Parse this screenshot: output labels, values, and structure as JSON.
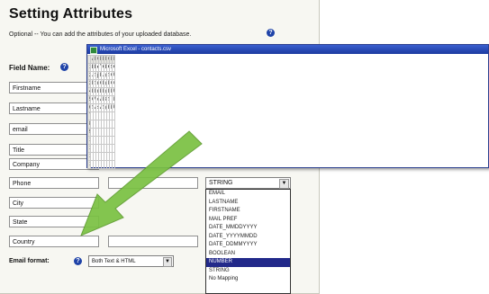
{
  "panel": {
    "title": "Setting Attributes",
    "subtitle": "Optional -- You can add the attributes of your uploaded database.",
    "help_glyph": "?",
    "field_name_label": "Field Name:",
    "fields": [
      "Firstname",
      "Lastname",
      "email",
      "Title",
      "Company",
      "Phone",
      "City",
      "State",
      "Country"
    ],
    "type_select": {
      "value": "STRING",
      "options": [
        "EMAIL",
        "LASTNAME",
        "FIRSTNAME",
        "MAIL PREF",
        "DATE_MMDDYYYY",
        "DATE_YYYYMMDD",
        "DATE_DDMMYYYY",
        "BOOLEAN",
        "NUMBER",
        "STRING",
        "No Mapping"
      ],
      "selected_index": 8
    },
    "email_format_label": "Email format:",
    "email_format_value": "Both Text & HTML",
    "arrow_glyph": "▼"
  },
  "excel": {
    "title": "Microsoft Excel - contacts.csv",
    "columns": [
      "",
      "A",
      "B",
      "C",
      "D",
      "E",
      "F",
      "G",
      "H",
      "I"
    ],
    "rows": [
      [
        "1",
        "Firstname",
        "Lastname",
        "email",
        "Title",
        "Company",
        "Phone",
        "City",
        "State",
        "Country"
      ],
      [
        "2",
        "Julie",
        "Smith",
        "jsmith@anec.co",
        "Buyer",
        "Jane's Clothing",
        "(416)555-1234",
        "San Diego",
        "CA",
        "USA"
      ],
      [
        "3",
        "May",
        "Steenberg",
        "mary@elegance",
        "Owner",
        "Elegance Bout.",
        "(514)555-5467",
        "Montreal",
        "QC",
        "Canada"
      ],
      [
        "4",
        "Paris",
        "Medina",
        "medina@medins",
        "President",
        "Medina Distrib.",
        "(888)555-8464",
        "Boston",
        "MA",
        "USA"
      ],
      [
        "5",
        "Catherine",
        "Wise",
        "cwise@newshi",
        "Account Mana",
        "New Shit Fabs",
        "82-02-555-123",
        "Seoul",
        "",
        "Korea"
      ],
      [
        "6",
        "Simone",
        "Alameda",
        "salameda@sent",
        "Accountant N",
        "Sentinelles Inc.",
        "(212)555-1356",
        "New York",
        "Ny",
        "USA"
      ],
      [
        "7",
        "",
        "",
        "",
        "",
        "",
        "",
        "",
        "",
        ""
      ],
      [
        "8",
        "",
        "",
        "",
        "",
        "",
        "",
        "",
        "",
        ""
      ],
      [
        "9",
        "",
        "",
        "",
        "",
        "",
        "",
        "",
        "",
        ""
      ],
      [
        "10",
        "",
        "",
        "",
        "",
        "",
        "",
        "",
        "",
        ""
      ],
      [
        "11",
        "",
        "",
        "",
        "",
        "",
        "",
        "",
        "",
        ""
      ],
      [
        "12",
        "",
        "",
        "",
        "",
        "",
        "",
        "",
        "",
        ""
      ],
      [
        "13",
        "",
        "",
        "",
        "",
        "",
        "",
        "",
        "",
        ""
      ]
    ]
  },
  "colors": {
    "accent_arrow": "#7ac142",
    "selection": "#22298a",
    "excel_title": "#1b3aa0"
  }
}
